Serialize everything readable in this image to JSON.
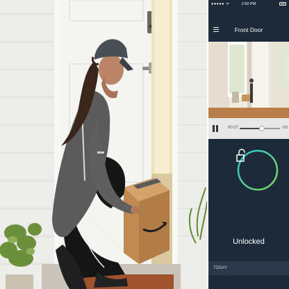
{
  "phone": {
    "status": {
      "carrier": "●●●●● ᯤ",
      "time": "2:50 PM"
    },
    "nav": {
      "title": "Front Door"
    },
    "playback": {
      "elapsed": "00:07",
      "remaining": "-00",
      "progress": 0.55
    },
    "lock": {
      "status": "Unlocked",
      "ring_color_start": "#2ec4d6",
      "ring_color_end": "#7ed957"
    },
    "history": {
      "section_label": "TODAY"
    }
  },
  "colors": {
    "phone_background": "#1c2a3a",
    "accent_teal": "#2ec4d6",
    "accent_green": "#7ed957"
  }
}
